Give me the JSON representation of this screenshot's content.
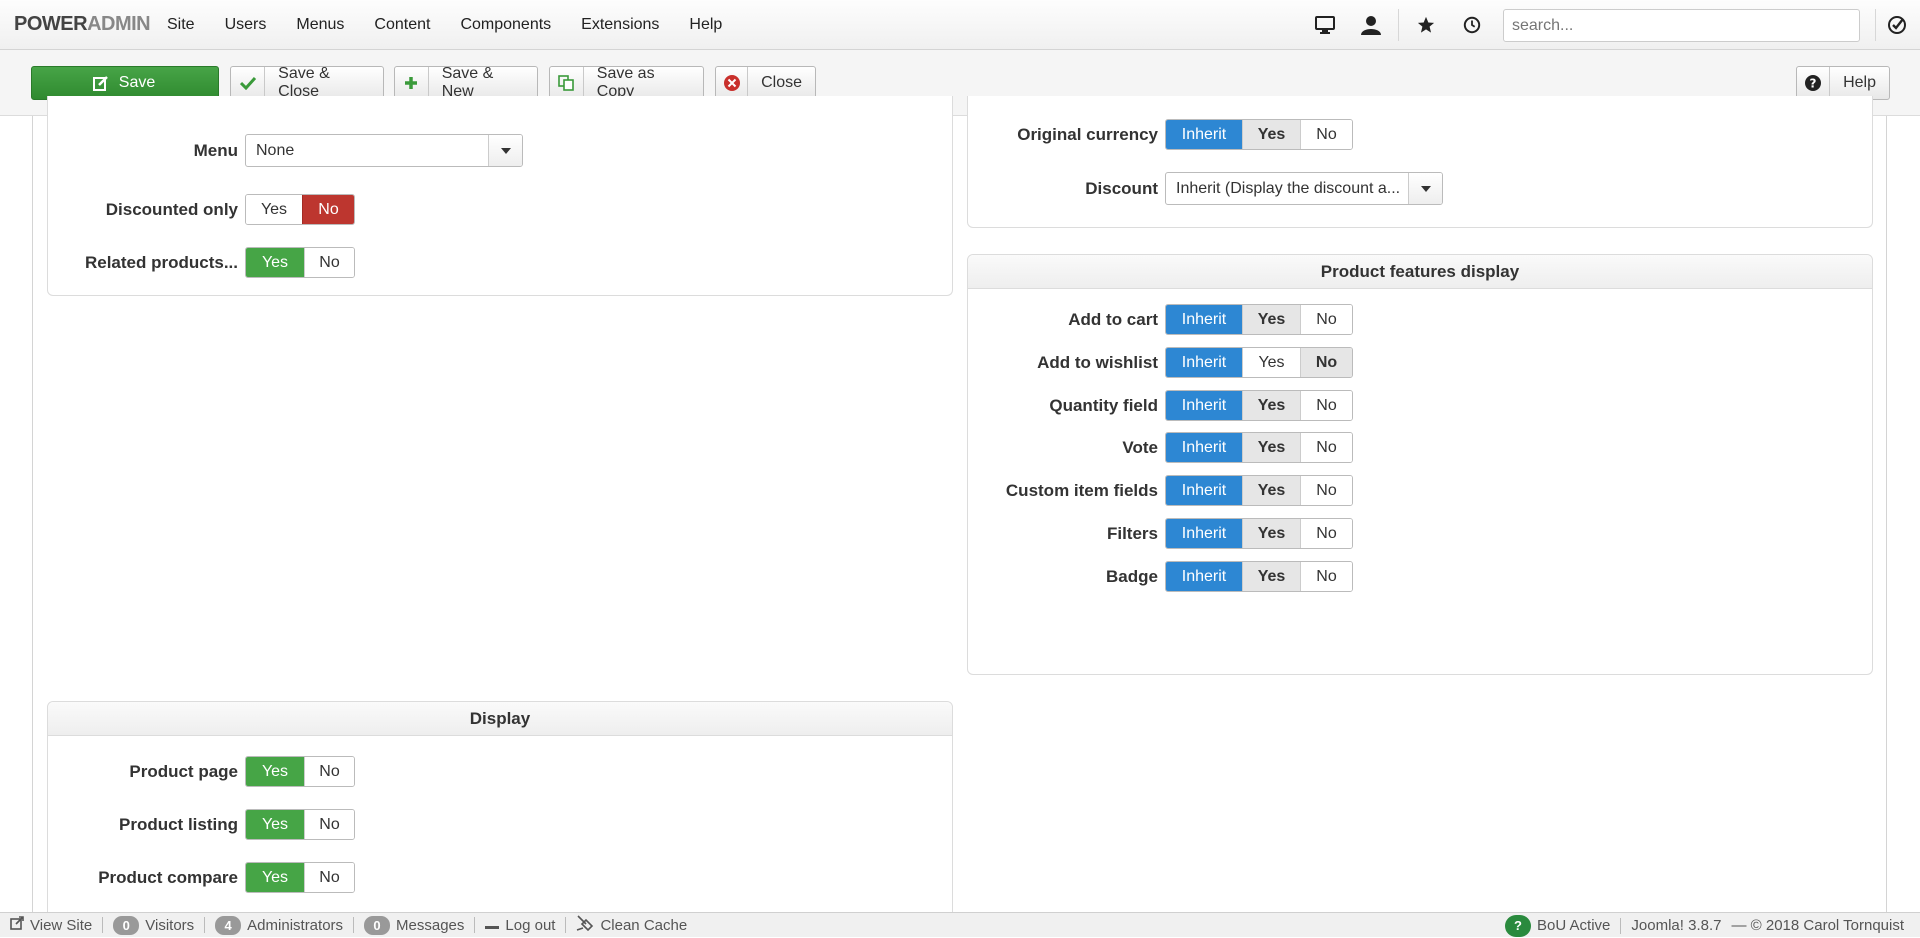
{
  "brand": {
    "power": "POWER",
    "admin": "ADMIN"
  },
  "topmenu": [
    "Site",
    "Users",
    "Menus",
    "Content",
    "Components",
    "Extensions",
    "Help"
  ],
  "search": {
    "placeholder": "search..."
  },
  "toolbar": {
    "save": "Save",
    "save_close": "Save & Close",
    "save_new": "Save & New",
    "save_copy": "Save as Copy",
    "close": "Close",
    "help": "Help"
  },
  "left_top": {
    "menu_label": "Menu",
    "menu_value": "None",
    "discounted_label": "Discounted only",
    "related_label": "Related products...",
    "yes": "Yes",
    "no": "No"
  },
  "right_top": {
    "original_currency_label": "Original currency",
    "discount_label": "Discount",
    "discount_value": "Inherit (Display the discount a..."
  },
  "features": {
    "title": "Product features display",
    "rows": [
      {
        "label": "Add to cart",
        "selected": "Inherit",
        "bold": "Yes"
      },
      {
        "label": "Add to wishlist",
        "selected": "Inherit",
        "bold": "No"
      },
      {
        "label": "Quantity field",
        "selected": "Inherit",
        "bold": "Yes"
      },
      {
        "label": "Vote",
        "selected": "Inherit",
        "bold": "Yes"
      },
      {
        "label": "Custom item fields",
        "selected": "Inherit",
        "bold": "Yes"
      },
      {
        "label": "Filters",
        "selected": "Inherit",
        "bold": "Yes"
      },
      {
        "label": "Badge",
        "selected": "Inherit",
        "bold": "Yes"
      }
    ],
    "inherit": "Inherit",
    "yes": "Yes",
    "no": "No"
  },
  "display": {
    "title": "Display",
    "rows": [
      {
        "label": "Product page",
        "value": "Yes"
      },
      {
        "label": "Product listing",
        "value": "Yes"
      },
      {
        "label": "Product compare",
        "value": "Yes"
      }
    ]
  },
  "statusbar": {
    "view_site": "View Site",
    "visitors_count": "0",
    "visitors": "Visitors",
    "admins_count": "4",
    "admins": "Administrators",
    "messages_count": "0",
    "messages": "Messages",
    "logout": "Log out",
    "clean_cache": "Clean Cache",
    "bou": "BoU Active",
    "joomla": "Joomla! 3.8.7",
    "copyright": "— © 2018 Carol Tornquist"
  },
  "colors": {
    "green": "#46a546",
    "red": "#bd362f",
    "blue": "#2d87d3"
  }
}
